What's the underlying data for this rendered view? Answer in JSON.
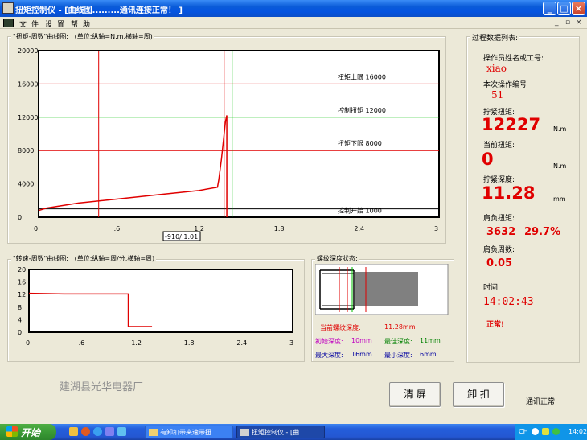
{
  "window": {
    "title": "扭矩控制仪 - [曲线图.........通讯连接正常！ ]",
    "min": "_",
    "max": "□",
    "close": "×"
  },
  "menu": {
    "items": [
      "文",
      "件",
      "设",
      "置",
      "帮",
      "助"
    ],
    "mdi_min": "_",
    "mdi_restore": "▫",
    "mdi_close": "×"
  },
  "torque_chart": {
    "title": "\"扭矩-周数\"曲线图:   (单位:纵轴=N.m,横轴=周)",
    "chart_data": {
      "type": "line",
      "xlim": [
        0,
        3
      ],
      "ylim": [
        0,
        20000
      ],
      "x_ticks": [
        "0",
        ".6",
        "1.2",
        "1.8",
        "2.4",
        "3"
      ],
      "y_ticks": [
        "0",
        "4000",
        "8000",
        "12000",
        "16000",
        "20000"
      ],
      "series": [
        {
          "x": [
            0,
            0.06,
            0.3,
            0.6,
            0.9,
            1.2,
            1.34,
            1.35,
            1.37,
            1.39,
            1.4,
            1.41,
            1.41
          ],
          "y": [
            800,
            1100,
            1700,
            2200,
            2700,
            3200,
            3600,
            4500,
            7000,
            10000,
            11500,
            12227,
            0
          ]
        }
      ],
      "hlines": [
        {
          "label": "扭矩上限 16000",
          "y": 16000,
          "color": "#E00000"
        },
        {
          "label": "控制扭矩 12000",
          "y": 12000,
          "color": "#00C000"
        },
        {
          "label": "扭矩下限 8000",
          "y": 8000,
          "color": "#E00000"
        },
        {
          "label": "控制开始 1000",
          "y": 1000,
          "color": "#000000"
        }
      ],
      "vlines": [
        {
          "x": 0.45,
          "color": "#E00000"
        },
        {
          "x": 1.39,
          "color": "#E00000"
        },
        {
          "x": 1.45,
          "color": "#00C000"
        }
      ],
      "cursor_label": "-910/ 1.01"
    }
  },
  "speed_chart": {
    "title": "\"转速-周数\"曲线图:   (单位:纵轴=周/分,横轴=周)",
    "chart_data": {
      "type": "line",
      "xlim": [
        0,
        3
      ],
      "ylim": [
        0,
        20
      ],
      "x_ticks": [
        "0",
        ".6",
        "1.2",
        "1.8",
        "2.4",
        "3"
      ],
      "y_ticks": [
        "0",
        "4",
        "8",
        "12",
        "16",
        "20"
      ],
      "series": [
        {
          "x": [
            0,
            0.4,
            1.1,
            1.13,
            1.13,
            1.4
          ],
          "y": [
            12.4,
            12.2,
            12.2,
            12.2,
            1.8,
            1.8
          ]
        }
      ]
    }
  },
  "thread": {
    "title": "螺纹深度状态:",
    "current_depth_label": "当前螺纹深度:",
    "current_depth_value": "11.28mm",
    "initial_depth_label": "初始深度:",
    "initial_depth_value": "10mm",
    "best_depth_label": "最佳深度:",
    "best_depth_value": "11mm",
    "max_depth_label": "最大深度:",
    "max_depth_value": "16mm",
    "min_depth_label": "最小深度:",
    "min_depth_value": "6mm"
  },
  "process": {
    "title": "过程数据列表:",
    "operator_label": "操作员姓名或工号:",
    "operator_value": "xiao",
    "op_no_label": "本次操作编号",
    "op_no_value": "51",
    "tight_torque_label": "拧紧扭矩:",
    "tight_torque_value": "12227",
    "torque_unit": "N.m",
    "current_torque_label": "当前扭矩:",
    "current_torque_value": "0",
    "current_torque_unit": "N.m",
    "depth_label": "拧紧深度:",
    "depth_value": "11.28",
    "depth_unit": "mm",
    "shoulder_torque_label": "肩负扭矩:",
    "shoulder_torque_value": "3632",
    "shoulder_torque_pct": "29.7%",
    "shoulder_turns_label": "肩负周数:",
    "shoulder_turns_value": "0.05",
    "time_label": "时间:",
    "time_value": "14:02:43",
    "status_value": "正常!"
  },
  "company": "建湖县光华电器厂",
  "buttons": {
    "clear": "清  屏",
    "unload": "卸  扣"
  },
  "comm_status": "通讯正常",
  "taskbar": {
    "start": "开始",
    "tasks": [
      "有卸扣带夹速带扭...",
      "扭矩控制仪 - [曲..."
    ],
    "ime": "CH",
    "clock": "14:02"
  }
}
